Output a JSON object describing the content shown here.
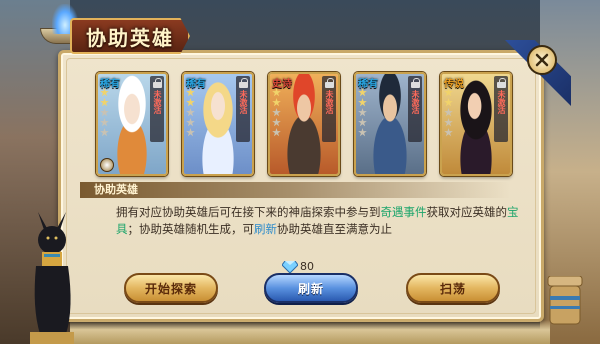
{
  "dialog": {
    "title": "协助英雄"
  },
  "heroes": [
    {
      "rarity": "稀有",
      "stars_on": 2,
      "stars_total": 5,
      "status": "未激活",
      "rarity_color": "#2aa8e6"
    },
    {
      "rarity": "稀有",
      "stars_on": 2,
      "stars_total": 5,
      "status": "未激活",
      "rarity_color": "#2aa8e6"
    },
    {
      "rarity": "史诗",
      "stars_on": 2,
      "stars_total": 5,
      "status": "未激活",
      "rarity_color": "#e04a3a"
    },
    {
      "rarity": "稀有",
      "stars_on": 2,
      "stars_total": 5,
      "status": "未激活",
      "rarity_color": "#2aa8e6"
    },
    {
      "rarity": "传说",
      "stars_on": 2,
      "stars_total": 5,
      "status": "未激活",
      "rarity_color": "#f0a020"
    }
  ],
  "section": {
    "title": "协助英雄"
  },
  "description": {
    "part1": "拥有对应协助英雄后可在接下来的神庙探索中参与到",
    "link1": "奇遇事件",
    "part2": "获取对应英雄的",
    "link2": "宝具",
    "part3": "；协助英雄随机生成，可",
    "link3": "刷新",
    "part4": "协助英雄直至满意为止"
  },
  "cost": {
    "value": "80",
    "icon": "diamond-icon"
  },
  "buttons": {
    "start": "开始探索",
    "refresh": "刷新",
    "sweep": "扫荡"
  },
  "colors": {
    "green_highlight": "#1da56b",
    "blue_highlight": "#2a8acb",
    "panel_bg": "#efe4cc"
  }
}
